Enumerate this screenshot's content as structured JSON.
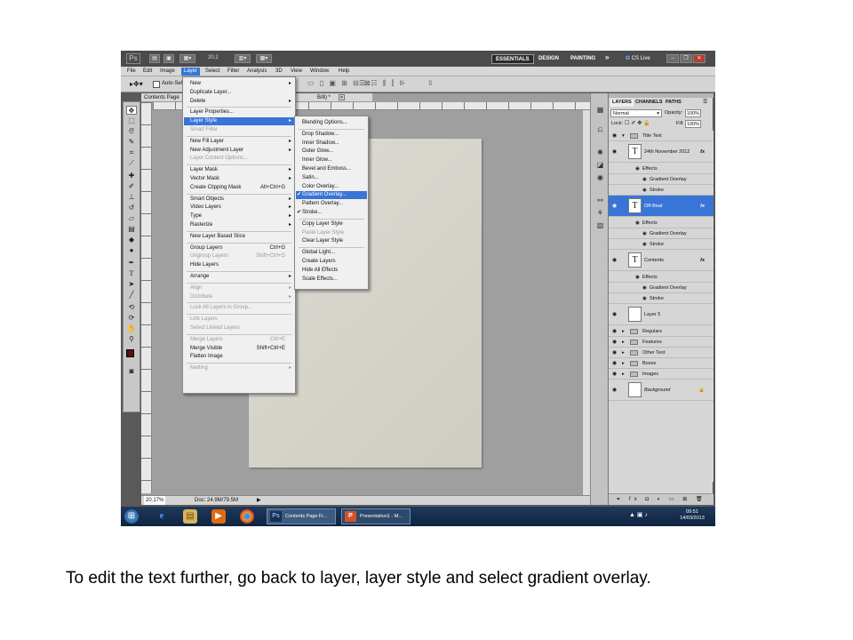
{
  "app": {
    "logo": "Ps",
    "zoom": "20.2",
    "cs_live": "CS Live"
  },
  "workspaces": [
    "ESSENTIALS",
    "DESIGN",
    "PAINTING"
  ],
  "menubar": [
    "File",
    "Edit",
    "Image",
    "Layer",
    "Select",
    "Filter",
    "Analysis",
    "3D",
    "View",
    "Window",
    "Help"
  ],
  "options_bar": {
    "auto_select": "Auto-Sele"
  },
  "document": {
    "tab_label": "Contents Page",
    "tab_suffix": "B/8) *",
    "zoom_status": "20.17%",
    "doc_size": "Doc: 24.9M/79.5M"
  },
  "layer_menu": [
    {
      "label": "New",
      "arrow": true
    },
    {
      "label": "Duplicate Layer..."
    },
    {
      "label": "Delete",
      "arrow": true
    },
    {
      "sep": true
    },
    {
      "label": "Layer Properties..."
    },
    {
      "label": "Layer Style",
      "arrow": true,
      "highlight": true
    },
    {
      "label": "Smart Filter",
      "disabled": true
    },
    {
      "sep": true
    },
    {
      "label": "New Fill Layer",
      "arrow": true
    },
    {
      "label": "New Adjustment Layer",
      "arrow": true
    },
    {
      "label": "Layer Content Options...",
      "disabled": true
    },
    {
      "sep": true
    },
    {
      "label": "Layer Mask",
      "arrow": true
    },
    {
      "label": "Vector Mask",
      "arrow": true
    },
    {
      "label": "Create Clipping Mask",
      "shortcut": "Alt+Ctrl+G"
    },
    {
      "sep": true
    },
    {
      "label": "Smart Objects",
      "arrow": true
    },
    {
      "label": "Video Layers",
      "arrow": true
    },
    {
      "label": "Type",
      "arrow": true
    },
    {
      "label": "Rasterize",
      "arrow": true
    },
    {
      "sep": true
    },
    {
      "label": "New Layer Based Slice"
    },
    {
      "sep": true
    },
    {
      "label": "Group Layers",
      "shortcut": "Ctrl+G"
    },
    {
      "label": "Ungroup Layers",
      "shortcut": "Shift+Ctrl+G",
      "disabled": true
    },
    {
      "label": "Hide Layers"
    },
    {
      "sep": true
    },
    {
      "label": "Arrange",
      "arrow": true
    },
    {
      "sep": true
    },
    {
      "label": "Align",
      "arrow": true,
      "disabled": true
    },
    {
      "label": "Distribute",
      "arrow": true,
      "disabled": true
    },
    {
      "sep": true
    },
    {
      "label": "Lock All Layers in Group...",
      "disabled": true
    },
    {
      "sep": true
    },
    {
      "label": "Link Layers",
      "disabled": true
    },
    {
      "label": "Select Linked Layers",
      "disabled": true
    },
    {
      "sep": true
    },
    {
      "label": "Merge Layers",
      "shortcut": "Ctrl+E",
      "disabled": true
    },
    {
      "label": "Merge Visible",
      "shortcut": "Shift+Ctrl+E"
    },
    {
      "label": "Flatten Image"
    },
    {
      "sep": true
    },
    {
      "label": "Matting",
      "arrow": true,
      "disabled": true
    }
  ],
  "style_submenu": [
    {
      "label": "Blending Options..."
    },
    {
      "sep": true
    },
    {
      "label": "Drop Shadow..."
    },
    {
      "label": "Inner Shadow..."
    },
    {
      "label": "Outer Glow..."
    },
    {
      "label": "Inner Glow..."
    },
    {
      "label": "Bevel and Emboss..."
    },
    {
      "label": "Satin..."
    },
    {
      "label": "Color Overlay..."
    },
    {
      "label": "Gradient Overlay...",
      "checked": true,
      "highlight": true
    },
    {
      "label": "Pattern Overlay..."
    },
    {
      "label": "Stroke...",
      "checked": true
    },
    {
      "sep": true
    },
    {
      "label": "Copy Layer Style"
    },
    {
      "label": "Paste Layer Style",
      "disabled": true
    },
    {
      "label": "Clear Layer Style"
    },
    {
      "sep": true
    },
    {
      "label": "Global Light..."
    },
    {
      "label": "Create Layers"
    },
    {
      "label": "Hide All Effects"
    },
    {
      "label": "Scale Effects..."
    }
  ],
  "layers_panel": {
    "tabs": [
      "LAYERS",
      "CHANNELS",
      "PATHS"
    ],
    "blend_mode": "Normal",
    "opacity_label": "Opacity:",
    "opacity": "100%",
    "lock_label": "Lock:",
    "fill_label": "Fill:",
    "fill": "100%",
    "rows": [
      {
        "kind": "group",
        "label": "Title Text",
        "open": true
      },
      {
        "kind": "text",
        "label": "24th November 2012",
        "fx": true
      },
      {
        "kind": "effect",
        "label": "Effects"
      },
      {
        "kind": "subeffect",
        "label": "Gradient Overlay"
      },
      {
        "kind": "subeffect",
        "label": "Stroke"
      },
      {
        "kind": "text",
        "label": "Off-Beat",
        "fx": true,
        "selected": true
      },
      {
        "kind": "effect",
        "label": "Effects"
      },
      {
        "kind": "subeffect",
        "label": "Gradient Overlay"
      },
      {
        "kind": "subeffect",
        "label": "Stroke"
      },
      {
        "kind": "text",
        "label": "Contents",
        "fx": true
      },
      {
        "kind": "effect",
        "label": "Effects"
      },
      {
        "kind": "subeffect",
        "label": "Gradient Overlay"
      },
      {
        "kind": "subeffect",
        "label": "Stroke"
      },
      {
        "kind": "layer",
        "label": "Layer 5"
      },
      {
        "kind": "group",
        "label": "Regulars"
      },
      {
        "kind": "group",
        "label": "Features"
      },
      {
        "kind": "group",
        "label": "Other Text"
      },
      {
        "kind": "group",
        "label": "Boxes"
      },
      {
        "kind": "group",
        "label": "Images"
      },
      {
        "kind": "background",
        "label": "Background"
      }
    ]
  },
  "taskbar": {
    "tasks": [
      "Contents Page Fi...",
      "Presentation1 - M..."
    ],
    "time": "09:51",
    "date": "14/03/2013"
  },
  "caption": "To edit the text further, go back to layer, layer style and select gradient overlay."
}
